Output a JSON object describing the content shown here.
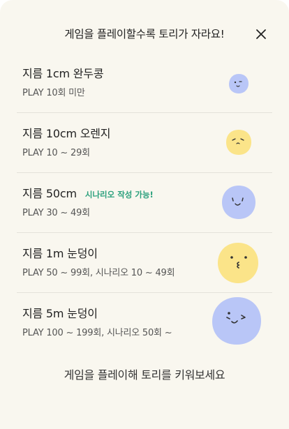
{
  "header": {
    "title": "게임을 플레이할수록 토리가 자라요!"
  },
  "levels": [
    {
      "name": "지름 1cm 완두콩",
      "condition": "PLAY 10회 미만",
      "tag": "",
      "character": "pea-character-icon",
      "color": "#b9c6f7"
    },
    {
      "name": "지름 10cm 오렌지",
      "condition": "PLAY 10 ~ 29회",
      "tag": "",
      "character": "orange-character-icon",
      "color": "#fbe489"
    },
    {
      "name": "지름 50cm",
      "condition": "PLAY 30 ~ 49회",
      "tag": "시나리오 작성 가능!",
      "character": "ball-character-icon",
      "color": "#b9c6f7"
    },
    {
      "name": "지름 1m 눈덩이",
      "condition": "PLAY 50 ~ 99회, 시나리오 10 ~ 49회",
      "tag": "",
      "character": "snowball-yellow-character-icon",
      "color": "#fbe489"
    },
    {
      "name": "지름 5m 눈덩이",
      "condition": "PLAY 100 ~ 199회, 시나리오 50회 ~",
      "tag": "",
      "character": "snowball-blue-character-icon",
      "color": "#b9c6f7"
    }
  ],
  "footer": {
    "text": "게임을 플레이해 토리를 키워보세요"
  }
}
